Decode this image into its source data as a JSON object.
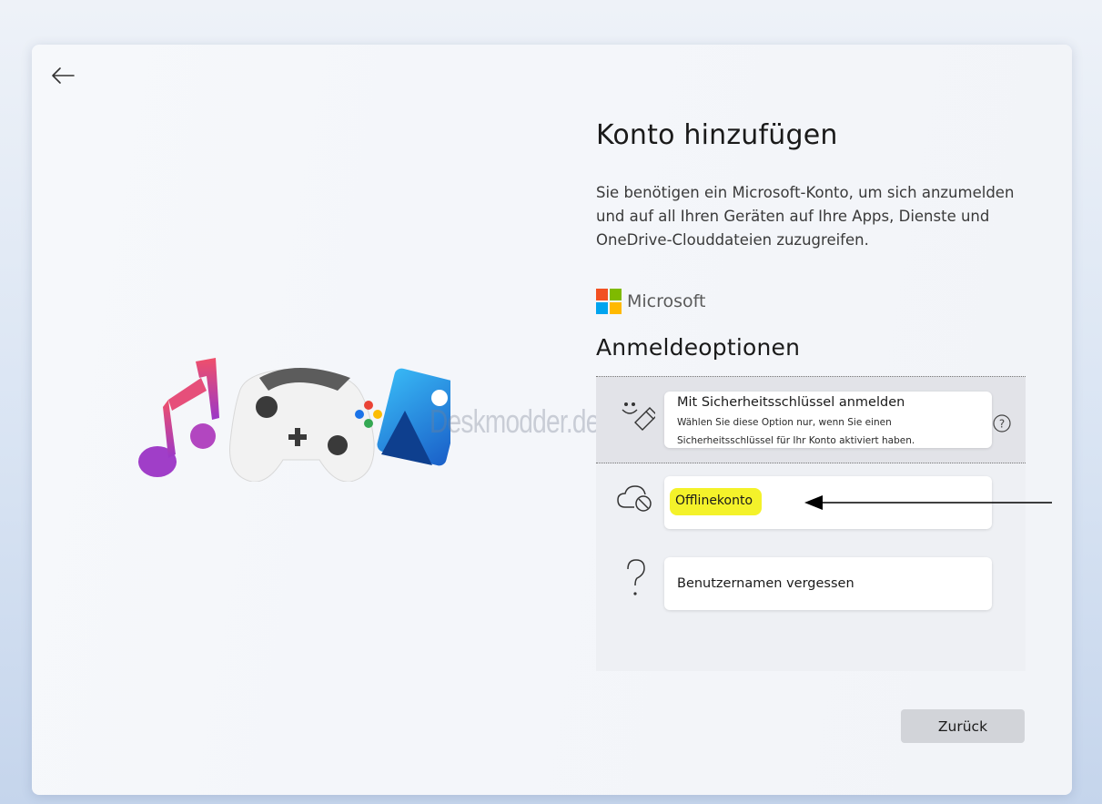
{
  "header": {
    "title": "Konto hinzufügen",
    "description": "Sie benötigen ein Microsoft-Konto, um sich anzumelden und auf all Ihren Geräten auf Ihre Apps, Dienste und OneDrive-Clouddateien zuzugreifen."
  },
  "brand": {
    "name": "Microsoft",
    "logo_colors": [
      "#f25022",
      "#7fba00",
      "#00a4ef",
      "#ffb900"
    ]
  },
  "watermark": "Deskmodder.de",
  "sign_in_options": {
    "title": "Anmeldeoptionen",
    "security_key": {
      "title": "Mit Sicherheitsschlüssel anmelden",
      "subtitle": "Wählen Sie diese Option nur, wenn Sie einen Sicherheitsschlüssel für Ihr Konto aktiviert haben.",
      "icon": "usb-key-icon",
      "help_icon": "help-circle-icon"
    },
    "offline": {
      "label": "Offlinekonto",
      "icon": "cloud-offline-icon",
      "highlight_color": "#f4f22a"
    },
    "forgot_username": {
      "label": "Benutzernamen vergessen",
      "icon": "question-mark-icon"
    }
  },
  "footer": {
    "back_label": "Zurück"
  },
  "nav": {
    "back_icon": "arrow-left-icon"
  }
}
